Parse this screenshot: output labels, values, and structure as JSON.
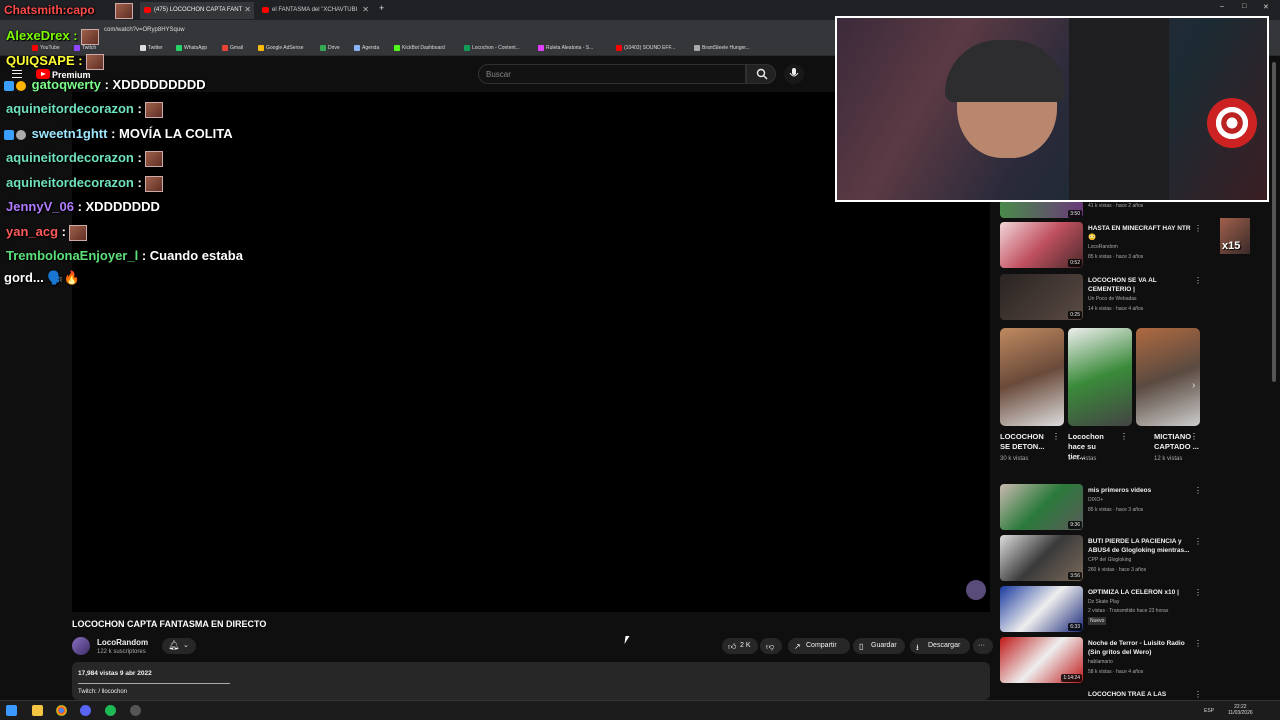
{
  "browser": {
    "tabs": [
      {
        "label": "(475) LOCOCHON CAPTA FANT"
      },
      {
        "label": "el FANTASMA del \"XCHAVTUBI"
      }
    ],
    "new_tab": "+",
    "url": "com/watch?v=ORyp8HYSquw",
    "bookmarks": [
      "YouTube",
      "Twitch",
      "Twitter",
      "WhatsApp",
      "Gmail",
      "Google AdSense",
      "Drive",
      "Agenda",
      "KickBot Dashboard",
      "Locochon - Content...",
      "Ruleta Aleatoria - S...",
      "(10403) SOUND EFF...",
      "BrantSteele Hunger..."
    ],
    "window_controls": {
      "min": "–",
      "max": "□",
      "close": "✕"
    }
  },
  "youtube": {
    "premium": "Premium",
    "search_placeholder": "Buscar",
    "video_title": "LOCOCHON CAPTA FANTASMA EN DIRECTO",
    "channel": "LocoRandom",
    "subscribers": "122 k suscriptores",
    "likes": "2 K",
    "share": "Compartir",
    "save": "Guardar",
    "download": "Descargar",
    "more": "···",
    "views_date": "17,984 vistas  9 abr 2022",
    "twitch_line": "Twitch:  / llocochon"
  },
  "chat": {
    "top_overlays": [
      {
        "user": "Chatsmith:capo",
        "color": "#ff4b4b"
      },
      {
        "user": "AlexeDrex",
        "color": "#7cfc00",
        "text": ":"
      },
      {
        "user": "QUIQSAPE",
        "color": "#ffff33",
        "text": ":"
      }
    ],
    "messages": [
      {
        "user": "gatoqwerty",
        "color": "#7cfc8a",
        "text": ": XDDDDDDDDD"
      },
      {
        "user": "aquineitordecorazon",
        "color": "#6fe3c0",
        "text": ":"
      },
      {
        "user": "sweetn1ghtt",
        "color": "#9fe8ff",
        "text": ": MOVÍA LA COLITA"
      },
      {
        "user": "aquineitordecorazon",
        "color": "#6fe3c0",
        "text": ":"
      },
      {
        "user": "aquineitordecorazon",
        "color": "#6fe3c0",
        "text": ":"
      },
      {
        "user": "JennyV_06",
        "color": "#b07cff",
        "text": ": XDDDDDDD"
      },
      {
        "user": "yan_acg",
        "color": "#ff5a5a",
        "text": ":"
      },
      {
        "user": "TrembolonaEnjoyer_l",
        "color": "#5ce07a",
        "text": ": Cuando estaba"
      }
    ],
    "continuation": "gord... 🗣️🔥"
  },
  "recommendations": [
    {
      "title": "",
      "channel": "",
      "meta": "41 k vistas · hace 2 años",
      "duration": "3:50"
    },
    {
      "title": "HASTA EN MINECRAFT HAY NTR😳",
      "channel": "LocoRandom",
      "meta": "85 k vistas · hace 3 años",
      "duration": "0:52"
    },
    {
      "title": "LOCOCHON SE VA AL CEMENTERIO |",
      "channel": "Un Poco de Webadas",
      "meta": "14 k vistas · hace 4 años",
      "duration": "0:25"
    }
  ],
  "shorts": [
    {
      "title": "LOCOCHON SE DETON...",
      "views": "30 k vistas"
    },
    {
      "title": "Locochon hace su tier...",
      "views": "14 k vistas"
    },
    {
      "title": "MICTIANO CAPTADO ...",
      "views": "12 k vistas"
    }
  ],
  "recommendations2": [
    {
      "title": "mis primeros videos",
      "channel": "DIXO+",
      "meta": "85 k vistas · hace 3 años",
      "duration": "9:36"
    },
    {
      "title": "BUTI PIERDE LA PACIENCIA y ABUS4 de Glogloking mientras...",
      "channel": "CPP del Glogloking",
      "meta": "260 k vistas · hace 3 años",
      "duration": "3:56"
    },
    {
      "title": "OPTIMIZA LA CELERON x10 |",
      "channel": "Dz Skate Play",
      "meta": "2 vistas · Transmitido hace 23 horas",
      "extra": "Nuevo",
      "duration": "6:33"
    },
    {
      "title": "Noche de Terror - Luisito Radio (Sin gritos del Wero)",
      "channel": "hablamario",
      "meta": "58 k vistas · hace 4 años",
      "duration": "1:14:24"
    },
    {
      "title": "LOCOCHON TRAE A LAS",
      "channel": "",
      "meta": "",
      "duration": ""
    }
  ],
  "side_badge": "x15",
  "taskbar": {
    "lang": "ESP",
    "time": "22:22",
    "date": "11/03/2026"
  }
}
